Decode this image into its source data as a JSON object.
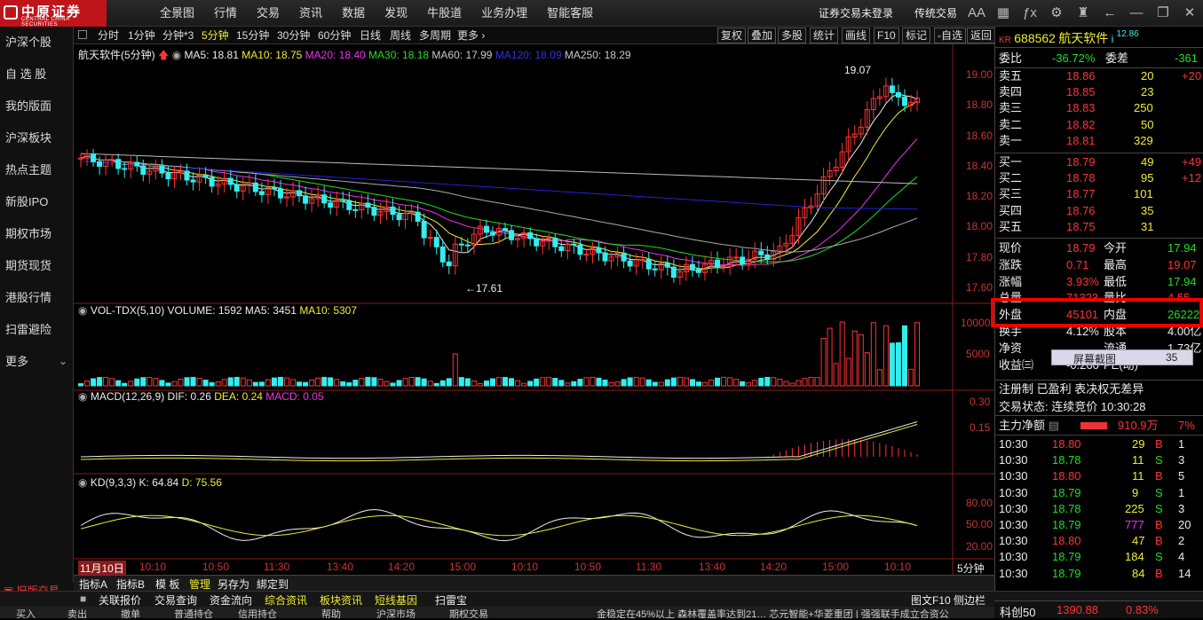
{
  "brand": {
    "cn": "中原证券",
    "en": "CENTRAL CHINA SECURITIES"
  },
  "top_menu": [
    "全景图",
    "行情",
    "交易",
    "资讯",
    "数据",
    "发现",
    "牛股道",
    "业务办理",
    "智能客服"
  ],
  "top_right": {
    "login": "证券交易未登录",
    "mode": "传统交易",
    "font": "AA"
  },
  "sidebar": [
    "沪深个股",
    "自 选 股",
    "我的版面",
    "沪深板块",
    "热点主题",
    "新股IPO",
    "期权市场",
    "期货现货",
    "港股行情",
    "扫雷避险",
    "更多"
  ],
  "sidebar_bottom": "旧版交易",
  "periods": [
    "分时",
    "1分钟",
    "分钟*3",
    "5分钟",
    "15分钟",
    "30分钟",
    "60分钟",
    "日线",
    "周线",
    "多周期",
    "更多 ›"
  ],
  "active_period": "5分钟",
  "tool_buttons": [
    "复权",
    "叠加",
    "多股",
    "统计",
    "画线",
    "F10",
    "标记",
    "-自选",
    "返回"
  ],
  "ma_line": {
    "name": "航天软件(5分钟)",
    "ma5": "MA5: 18.81",
    "ma10": "MA10: 18.75",
    "ma20": "MA20: 18.40",
    "ma30": "MA30: 18.18",
    "ma60": "MA60: 17.99",
    "ma120": "MA120: 18.09",
    "ma250": "MA250: 18.29"
  },
  "price_axis": [
    "19.00",
    "18.80",
    "18.60",
    "18.40",
    "18.20",
    "18.00",
    "17.80",
    "17.60"
  ],
  "high_label": "19.07",
  "low_label": "←17.61",
  "vol_line": {
    "name": "VOL-TDX(5,10)",
    "volume": "VOLUME: 1592",
    "ma5": "MA5: 3451",
    "ma10": "MA10: 5307"
  },
  "vol_axis": [
    "10000",
    "5000"
  ],
  "macd_line": {
    "name": "MACD(12,26,9)",
    "dif": "DIF: 0.26",
    "dea": "DEA: 0.24",
    "macd": "MACD: 0.05"
  },
  "macd_axis": [
    "0.30",
    "0.15"
  ],
  "kd_line": {
    "name": "KD(9,3,3)",
    "k": "K: 64.84",
    "d": "D: 75.56"
  },
  "kd_axis": [
    "80.00",
    "50.00",
    "20.00"
  ],
  "time_axis": [
    "11月10日",
    "10:10",
    "10:50",
    "11:30",
    "13:40",
    "14:20",
    "15:00",
    "10:10",
    "10:50",
    "11:30",
    "13:40",
    "14:20",
    "15:00",
    "10:10"
  ],
  "period_tag": "5分钟",
  "bottom_tabs": [
    "指标A",
    "指标B",
    "模 板",
    "管理",
    "另存为",
    "綁定到"
  ],
  "bottom_tabs2": [
    "关联报价",
    "交易查询",
    "资金流向",
    "综合资讯",
    "板块资讯",
    "短线基因",
    "扫雷宝"
  ],
  "bottom_right": "图文F10 侧边栏",
  "stock": {
    "tag": "KR",
    "code": "688562",
    "name": "航天软件",
    "mark": "i",
    "price_small": "12.86"
  },
  "weibi": {
    "label": "委比",
    "value": "-36.72%",
    "label2": "委差",
    "value2": "-361"
  },
  "sells": [
    [
      "卖五",
      "18.86",
      "20",
      "+20"
    ],
    [
      "卖四",
      "18.85",
      "23",
      ""
    ],
    [
      "卖三",
      "18.83",
      "250",
      ""
    ],
    [
      "卖二",
      "18.82",
      "50",
      ""
    ],
    [
      "卖一",
      "18.81",
      "329",
      ""
    ]
  ],
  "buys": [
    [
      "买一",
      "18.79",
      "49",
      "+49"
    ],
    [
      "买二",
      "18.78",
      "95",
      "+12"
    ],
    [
      "买三",
      "18.77",
      "101",
      ""
    ],
    [
      "买四",
      "18.76",
      "35",
      ""
    ],
    [
      "买五",
      "18.75",
      "31",
      ""
    ]
  ],
  "quote": [
    [
      "现价",
      "18.79",
      "今开",
      "17.94"
    ],
    [
      "涨跌",
      "0.71",
      "最高",
      "19.07"
    ],
    [
      "涨幅",
      "3.93%",
      "最低",
      "17.94"
    ],
    [
      "总量",
      "71323",
      "量比",
      "4.55"
    ],
    [
      "外盘",
      "45101",
      "内盘",
      "26222"
    ],
    [
      "换手",
      "4.12%",
      "股本",
      "4.00亿"
    ],
    [
      "净资",
      "",
      "流通",
      "1.73亿"
    ],
    [
      "收益㈢",
      "-0.260",
      "PE(动)",
      ""
    ]
  ],
  "screenshot_tip": {
    "label": "屏幕截图",
    "value": "35"
  },
  "reg": "注册制 已盈利 表决权无差异",
  "status": "交易状态: 连续竞价 10:30:28",
  "main_flow": {
    "label": "主力净额",
    "value": "910.9万",
    "pct": "7%"
  },
  "ticks": [
    [
      "10:30",
      "18.80",
      "29",
      "B"
    ],
    [
      "10:30",
      "18.78",
      "11",
      "S"
    ],
    [
      "10:30",
      "18.80",
      "11",
      "B"
    ],
    [
      "10:30",
      "18.79",
      "9",
      "S"
    ],
    [
      "10:30",
      "18.78",
      "225",
      "S"
    ],
    [
      "10:30",
      "18.79",
      "777",
      "B"
    ],
    [
      "10:30",
      "18.80",
      "47",
      "B"
    ],
    [
      "10:30",
      "18.79",
      "184",
      "S"
    ],
    [
      "10:30",
      "18.79",
      "84",
      "B"
    ]
  ],
  "tick_extra": [
    "1",
    "3",
    "5",
    "1",
    "3",
    "20",
    "2",
    "4",
    "14"
  ],
  "index_bar": {
    "name": "科创50",
    "value": "1390.88",
    "pct": "0.83%"
  },
  "bottom_menu": [
    "买入",
    "卖出",
    "撤单",
    "普通持仓",
    "信用持仓",
    "帮助",
    "沪深市场",
    "期权交易"
  ],
  "news": "金稳定在45%以上 森林覆盖率达到21… 芯元智能+华菱重团 | 强强联手成立合资公"
}
